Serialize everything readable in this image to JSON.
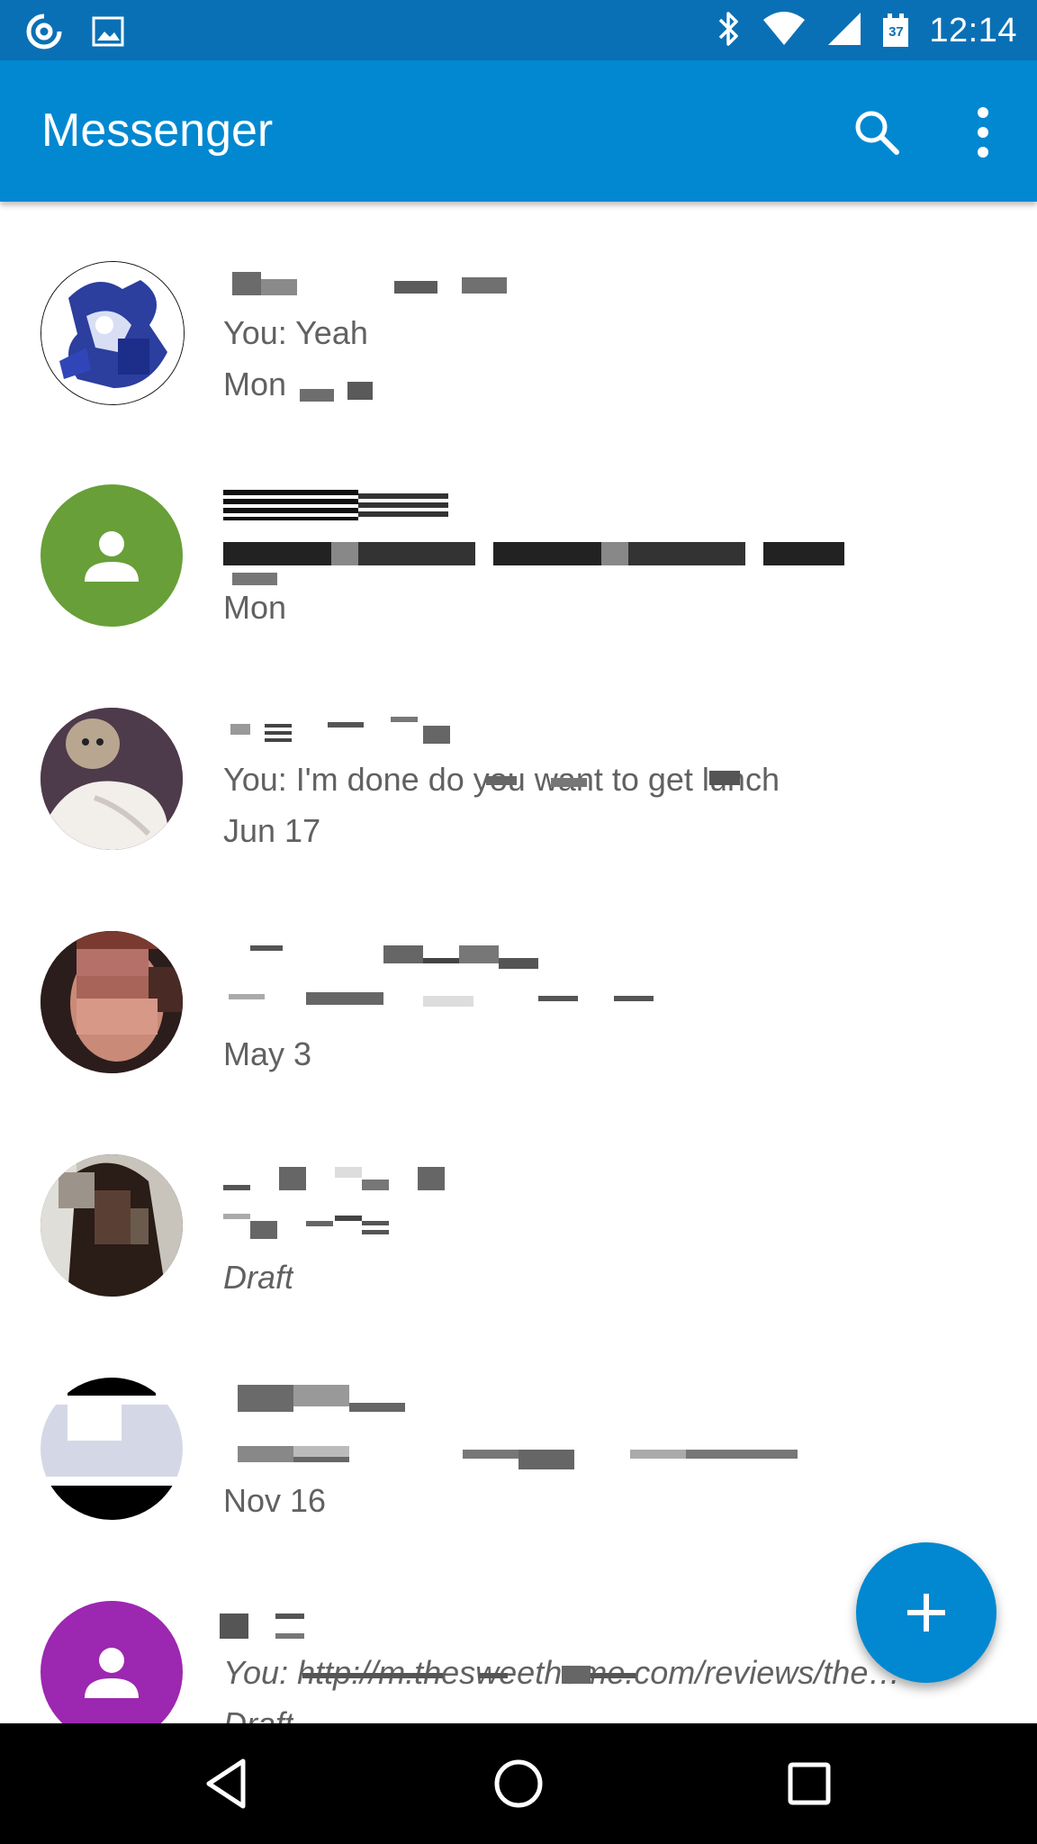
{
  "status_bar": {
    "time": "12:14",
    "calendar_day": "37",
    "icons": [
      "sync-icon",
      "image-icon",
      "bluetooth-icon",
      "wifi-icon",
      "signal-icon",
      "calendar-icon"
    ]
  },
  "app_bar": {
    "title": "Messenger",
    "icons": [
      "search-icon",
      "more-vert-icon"
    ]
  },
  "colors": {
    "status_bar": "#0a70b5",
    "app_bar": "#0288d1",
    "fab": "#0288d1",
    "avatar_green": "#689f38",
    "avatar_purple": "#9c27b0"
  },
  "conversations": [
    {
      "name": "",
      "snippet": "You: Yeah",
      "time": "Mon",
      "draft": false
    },
    {
      "name": "",
      "snippet": "",
      "time": "Mon",
      "draft": false
    },
    {
      "name": "",
      "snippet": "You: I'm done do you want to get lunch",
      "time": "Jun 17",
      "draft": false
    },
    {
      "name": "",
      "snippet": "",
      "time": "May 3",
      "draft": false
    },
    {
      "name": "",
      "snippet": "",
      "time": "Draft",
      "draft": true
    },
    {
      "name": "",
      "snippet": "",
      "time": "Nov 16",
      "draft": false
    },
    {
      "name": "",
      "snippet": "You: http://m.thesweethome.com/reviews/the…",
      "time": "Draft",
      "draft": true
    }
  ],
  "fab": {
    "icon": "add-icon"
  },
  "nav_bar": {
    "icons": [
      "back-icon",
      "home-icon",
      "recents-icon"
    ]
  }
}
